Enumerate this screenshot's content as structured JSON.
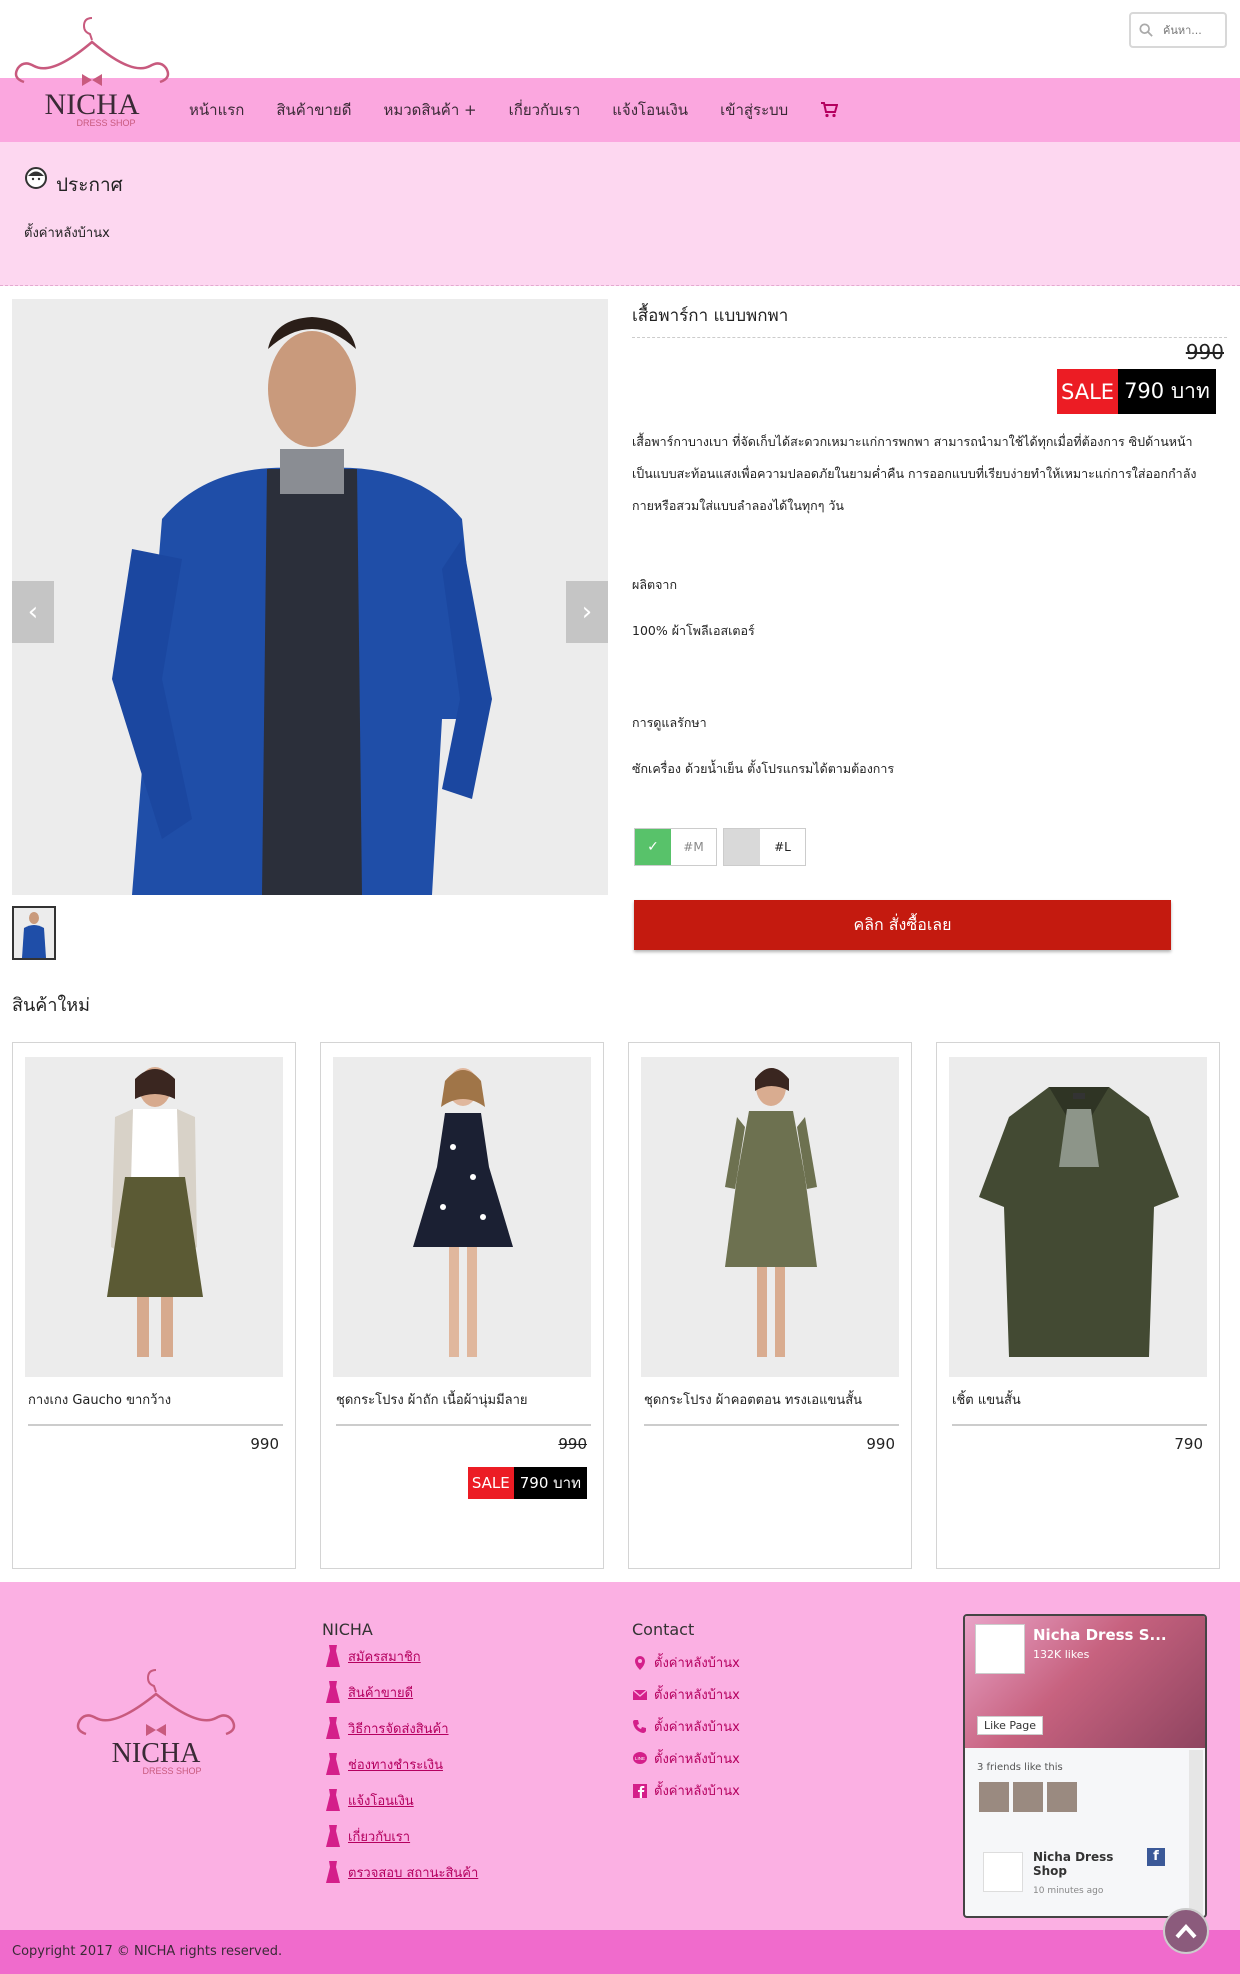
{
  "brand": {
    "name": "NICHA",
    "tagline": "DRESS SHOP"
  },
  "search": {
    "placeholder": "ค้นหา..."
  },
  "nav": {
    "items": [
      "หน้าแรก",
      "สินค้าขายดี",
      "หมวดสินค้า +",
      "เกี่ยวกับเรา",
      "แจ้งโอนเงิน",
      "เข้าสู่ระบบ"
    ]
  },
  "announcement": {
    "title": "ประกาศ",
    "text": "ตั้งค่าหลังบ้านx"
  },
  "product": {
    "name": "เสื้อพาร์กา แบบพกพา",
    "old_price": "990",
    "sale_label": "SALE",
    "sale_price": "790 บาท",
    "description_lines": [
      "เสื้อพาร์กาบางเบา ที่จัดเก็บได้สะดวกเหมาะแก่การพกพา สามารถนำมาใช้ได้ทุกเมื่อที่ต้องการ ซิปด้านหน้า",
      "เป็นแบบสะท้อนแสงเพื่อความปลอดภัยในยามค่ำคืน การออกแบบที่เรียบง่ายทำให้เหมาะแก่การใส่ออกกำลัง",
      "กายหรือสวมใส่แบบลำลองได้ในทุกๆ วัน"
    ],
    "material_label": "ผลิตจาก",
    "material_value": "100% ผ้าโพลีเอสเตอร์",
    "care_label": "การดูแลรักษา",
    "care_value": "ซักเครื่อง ด้วยน้ำเย็น ตั้งโปรแกรมได้ตามต้องการ",
    "sizes": [
      {
        "label": "#M",
        "selected": true
      },
      {
        "label": "#L",
        "selected": false
      }
    ],
    "buy_label": "คลิก สั่งซื้อเลย"
  },
  "new_products": {
    "title": "สินค้าใหม่",
    "items": [
      {
        "name": "กางเกง Gaucho ขากว้าง",
        "price": "990"
      },
      {
        "name": "ชุดกระโปรง ผ้าถัก เนื้อผ้านุ่มมีลาย",
        "price": "990",
        "sale_label": "SALE",
        "sale_price": "790 บาท"
      },
      {
        "name": "ชุดกระโปรง ผ้าคอตตอน ทรงเอแขนสั้น",
        "price": "990"
      },
      {
        "name": "เชิ้ต แขนสั้น",
        "price": "790"
      }
    ]
  },
  "footer": {
    "col1_title": "NICHA",
    "links": [
      "สมัครสมาชิก",
      "สินค้าขายดี",
      "วิธีการจัดส่งสินค้า",
      "ช่องทางชำระเงิน",
      "แจ้งโอนเงิน",
      "เกี่ยวกับเรา",
      "ตรวจสอบ สถานะสินค้า"
    ],
    "col2_title": "Contact",
    "contacts": [
      {
        "icon": "location-pin-icon",
        "text": "ตั้งค่าหลังบ้านx"
      },
      {
        "icon": "mail-icon",
        "text": "ตั้งค่าหลังบ้านx"
      },
      {
        "icon": "phone-icon",
        "text": "ตั้งค่าหลังบ้านx"
      },
      {
        "icon": "line-icon",
        "text": "ตั้งค่าหลังบ้านx"
      },
      {
        "icon": "facebook-icon",
        "text": "ตั้งค่าหลังบ้านx"
      }
    ],
    "fb": {
      "page_name": "Nicha Dress S...",
      "likes": "132K likes",
      "like_button": "Like Page",
      "friends": "3 friends like this",
      "post_name_1": "Nicha Dress",
      "post_name_2": "Shop",
      "post_time": "10 minutes ago"
    },
    "copyright": "Copyright 2017 © NICHA rights reserved."
  },
  "colors": {
    "nav_pink": "#fba7df",
    "announce_pink": "#fdd7f0",
    "buy_red": "#c41a0f",
    "sale_red": "#ec1c24",
    "footer_pink": "#fbb0e3",
    "copyright_pink": "#f06bcc"
  }
}
